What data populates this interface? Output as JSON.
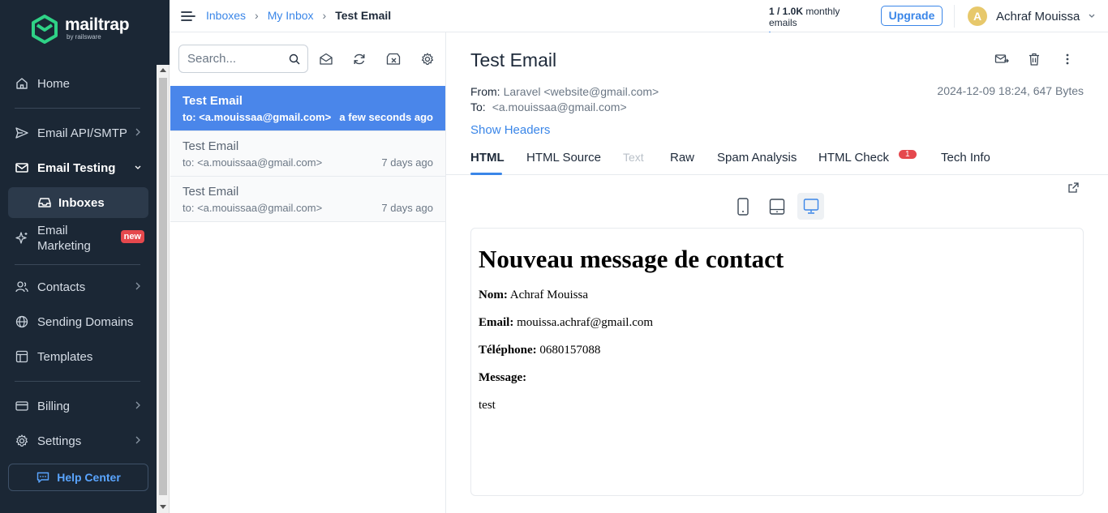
{
  "brand": {
    "name": "mailtrap",
    "sub": "by railsware"
  },
  "sidebar": {
    "items": [
      {
        "label": "Home",
        "icon": "home-icon"
      },
      {
        "label": "Email API/SMTP",
        "icon": "send-icon"
      },
      {
        "label": "Email Testing",
        "icon": "envelope-icon"
      },
      {
        "label": "Inboxes",
        "icon": "inbox-icon"
      },
      {
        "label": "Email Marketing",
        "icon": "sparkle-icon",
        "badge": "new"
      },
      {
        "label": "Contacts",
        "icon": "contacts-icon"
      },
      {
        "label": "Sending Domains",
        "icon": "globe-icon"
      },
      {
        "label": "Templates",
        "icon": "templates-icon"
      },
      {
        "label": "Billing",
        "icon": "billing-icon"
      },
      {
        "label": "Settings",
        "icon": "gear-icon"
      }
    ],
    "help": "Help Center"
  },
  "breadcrumb": {
    "items": [
      "Inboxes",
      "My Inbox"
    ],
    "current": "Test Email"
  },
  "usage": {
    "count": "1 / 1.0K",
    "label": "monthly emails",
    "fraction": 0.001
  },
  "upgrade": "Upgrade",
  "user": {
    "initial": "A",
    "name": "Achraf Mouissa"
  },
  "search": {
    "placeholder": "Search..."
  },
  "messages": [
    {
      "subject": "Test Email",
      "to": "to: <a.mouissaa@gmail.com>",
      "time": "a few seconds ago",
      "active": true
    },
    {
      "subject": "Test Email",
      "to": "to: <a.mouissaa@gmail.com>",
      "time": "7 days ago",
      "active": false
    },
    {
      "subject": "Test Email",
      "to": "to: <a.mouissaa@gmail.com>",
      "time": "7 days ago",
      "active": false
    }
  ],
  "email": {
    "title": "Test Email",
    "from_label": "From:",
    "from": "Laravel <website@gmail.com>",
    "to_label": "To:",
    "to": "<a.mouissaa@gmail.com>",
    "date_size": "2024-12-09 18:24, 647 Bytes",
    "show_headers": "Show Headers"
  },
  "tabs": [
    {
      "label": "HTML",
      "state": "active"
    },
    {
      "label": "HTML Source",
      "state": "normal"
    },
    {
      "label": "Text",
      "state": "disabled"
    },
    {
      "label": "Raw",
      "state": "normal"
    },
    {
      "label": "Spam Analysis",
      "state": "normal"
    },
    {
      "label": "HTML Check",
      "state": "normal",
      "badge": "1"
    },
    {
      "label": "Tech Info",
      "state": "normal"
    }
  ],
  "preview": {
    "heading": "Nouveau message de contact",
    "fields": [
      {
        "label": "Nom:",
        "value": "Achraf Mouissa"
      },
      {
        "label": "Email:",
        "value": "mouissa.achraf@gmail.com"
      },
      {
        "label": "Téléphone:",
        "value": "0680157088"
      },
      {
        "label": "Message:",
        "value": ""
      }
    ],
    "body": "test"
  },
  "colors": {
    "sidebar": "#1b2735",
    "accent": "#3a86e8",
    "selected_row": "#4a86ea",
    "badge_red": "#e5484d",
    "avatar": "#e7c86b"
  }
}
